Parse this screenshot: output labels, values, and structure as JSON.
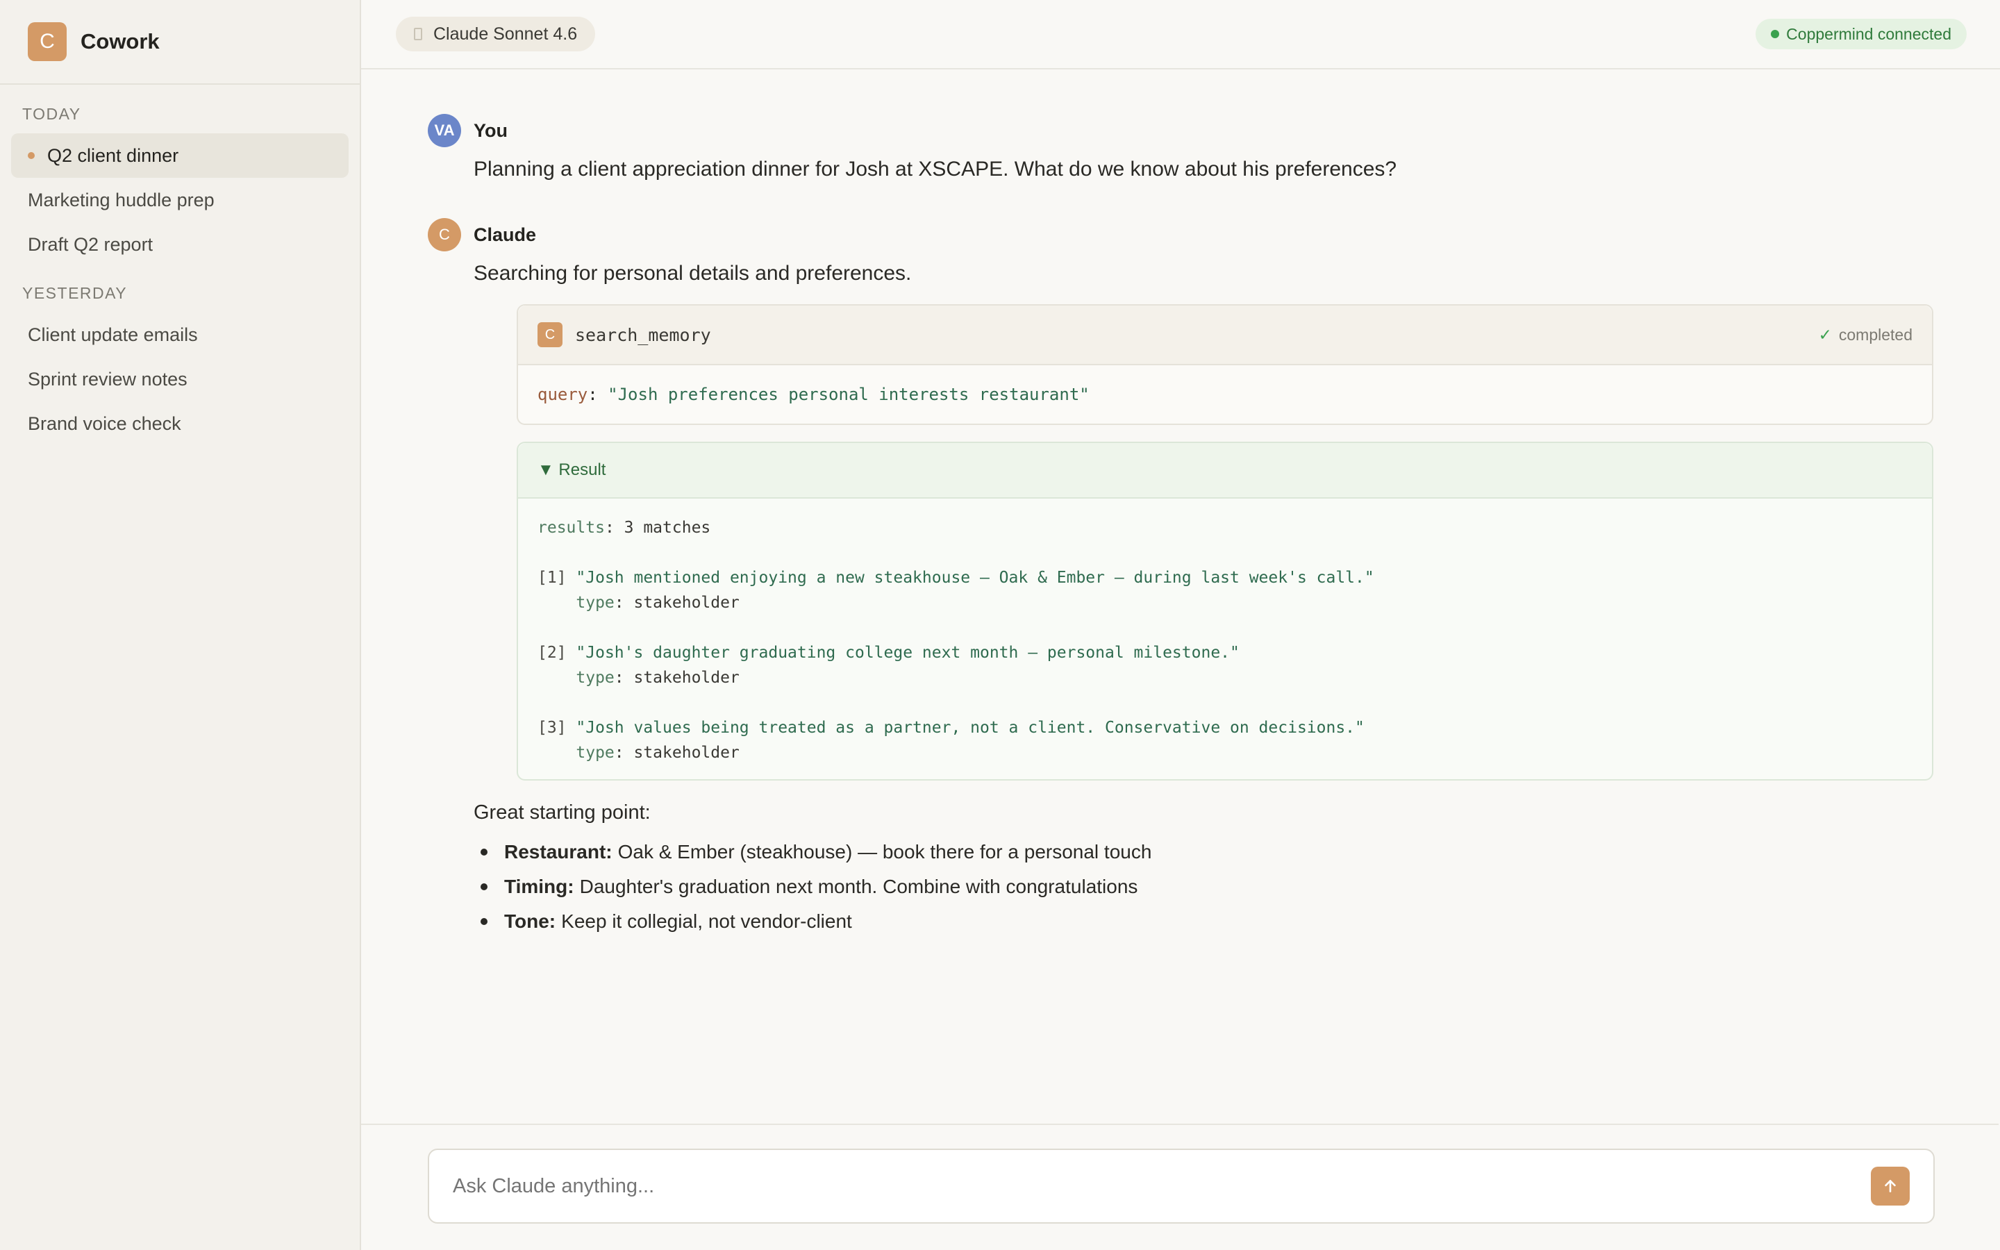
{
  "brand": {
    "logo_letter": "C",
    "name": "Cowork"
  },
  "sidebar": {
    "today_label": "TODAY",
    "today_items": [
      "Q2 client dinner",
      "Marketing huddle prep",
      "Draft Q2 report"
    ],
    "yesterday_label": "YESTERDAY",
    "yesterday_items": [
      "Client update emails",
      "Sprint review notes",
      "Brand voice check"
    ]
  },
  "topbar": {
    "model": "Claude Sonnet 4.6",
    "status": "Coppermind connected"
  },
  "messages": {
    "user": {
      "avatar": "VA",
      "sender": "You",
      "text": "Planning a client appreciation dinner for Josh at XSCAPE. What do we know about his preferences?"
    },
    "assistant": {
      "avatar": "C",
      "sender": "Claude",
      "intro": "Searching for personal details and preferences.",
      "tool": {
        "icon_letter": "C",
        "name": "search_memory",
        "status": "completed",
        "query_key": "query",
        "query_value": "\"Josh preferences personal interests restaurant\""
      },
      "result": {
        "header": "▼ Result",
        "summary_key": "results",
        "summary_value": "3 matches",
        "items": [
          {
            "index": "[1]",
            "text": "\"Josh mentioned enjoying a new steakhouse — Oak & Ember — during last week's call.\"",
            "type_key": "type",
            "type_value": "stakeholder"
          },
          {
            "index": "[2]",
            "text": "\"Josh's daughter graduating college next month — personal milestone.\"",
            "type_key": "type",
            "type_value": "stakeholder"
          },
          {
            "index": "[3]",
            "text": "\"Josh values being treated as a partner, not a client. Conservative on decisions.\"",
            "type_key": "type",
            "type_value": "stakeholder"
          }
        ]
      },
      "followup": "Great starting point:",
      "bullets": [
        {
          "label": "Restaurant:",
          "text": "Oak & Ember (steakhouse) — book there for a personal touch"
        },
        {
          "label": "Timing:",
          "text": "Daughter's graduation next month. Combine with congratulations"
        },
        {
          "label": "Tone:",
          "text": "Keep it collegial, not vendor-client"
        }
      ]
    }
  },
  "composer": {
    "placeholder": "Ask Claude anything...",
    "send_icon": "arrow-up-icon"
  }
}
